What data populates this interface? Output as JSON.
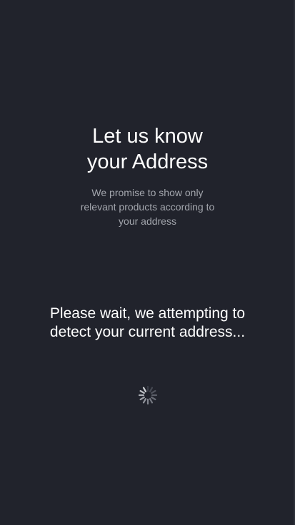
{
  "header": {
    "title_line1": "Let us know",
    "title_line2": "your Address",
    "subtitle": "We promise to show only relevant products according to your address"
  },
  "status": {
    "message": "Please wait, we attempting to detect your current address...",
    "spinner_icon": "loading-spinner-icon"
  },
  "colors": {
    "background": "#21232c",
    "title": "#ffffff",
    "subtitle": "#a3a6ad"
  }
}
